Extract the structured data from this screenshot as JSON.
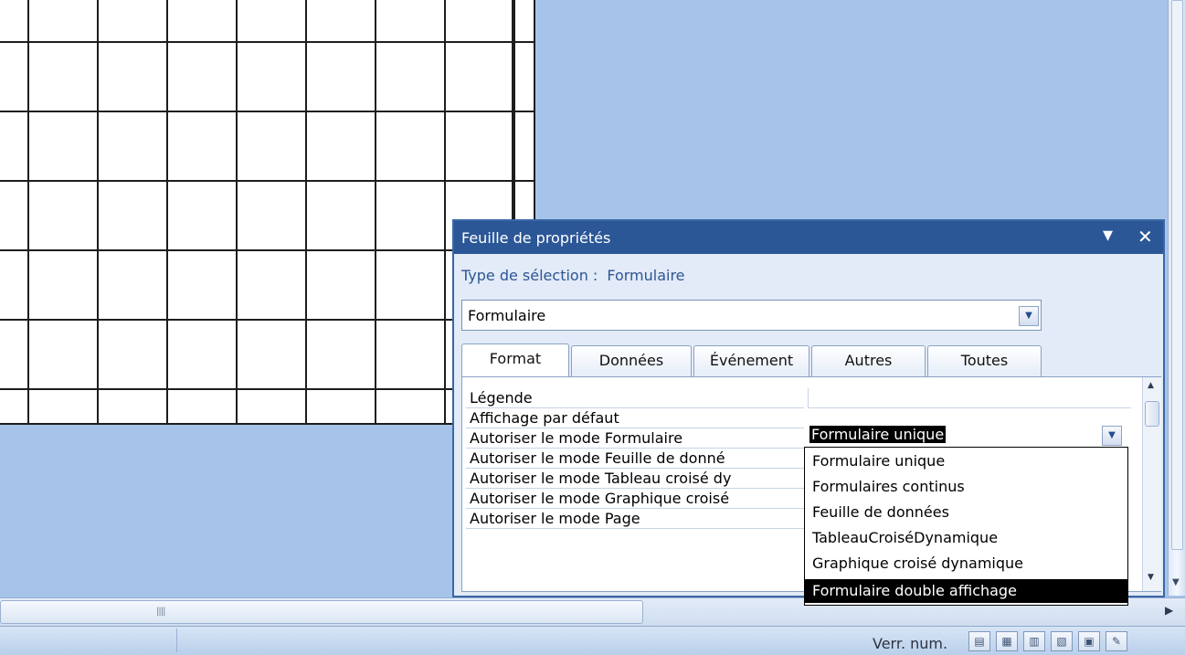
{
  "property_sheet": {
    "title": "Feuille de propriétés",
    "selection_label": "Type de sélection :",
    "selection_value": "Formulaire",
    "object_combo_value": "Formulaire",
    "tabs": [
      {
        "label": "Format",
        "active": true
      },
      {
        "label": "Données",
        "active": false
      },
      {
        "label": "Événement",
        "active": false
      },
      {
        "label": "Autres",
        "active": false
      },
      {
        "label": "Toutes",
        "active": false
      }
    ],
    "properties": [
      {
        "label": "Légende"
      },
      {
        "label": "Affichage par défaut",
        "value": "Formulaire unique"
      },
      {
        "label": "Autoriser le mode Formulaire"
      },
      {
        "label": "Autoriser le mode Feuille de donné"
      },
      {
        "label": "Autoriser le mode Tableau croisé dy"
      },
      {
        "label": "Autoriser le mode Graphique croisé"
      },
      {
        "label": "Autoriser le mode Page"
      }
    ]
  },
  "dropdown": {
    "options": [
      {
        "label": "Formulaire unique"
      },
      {
        "label": "Formulaires continus"
      },
      {
        "label": "Feuille de données"
      },
      {
        "label": "TableauCroiséDynamique"
      },
      {
        "label": "Graphique croisé dynamique"
      },
      {
        "label": "Formulaire double affichage",
        "highlighted": true
      }
    ]
  },
  "status_bar": {
    "num_lock": "Verr. num."
  },
  "icons": {
    "collapse": "triangle-down-icon",
    "close": "close-icon",
    "combo": "chevron-down-icon"
  },
  "colors": {
    "title_bar": "#2b5797",
    "workspace": "#a6c4ea",
    "panel": "#e2ebf7"
  }
}
